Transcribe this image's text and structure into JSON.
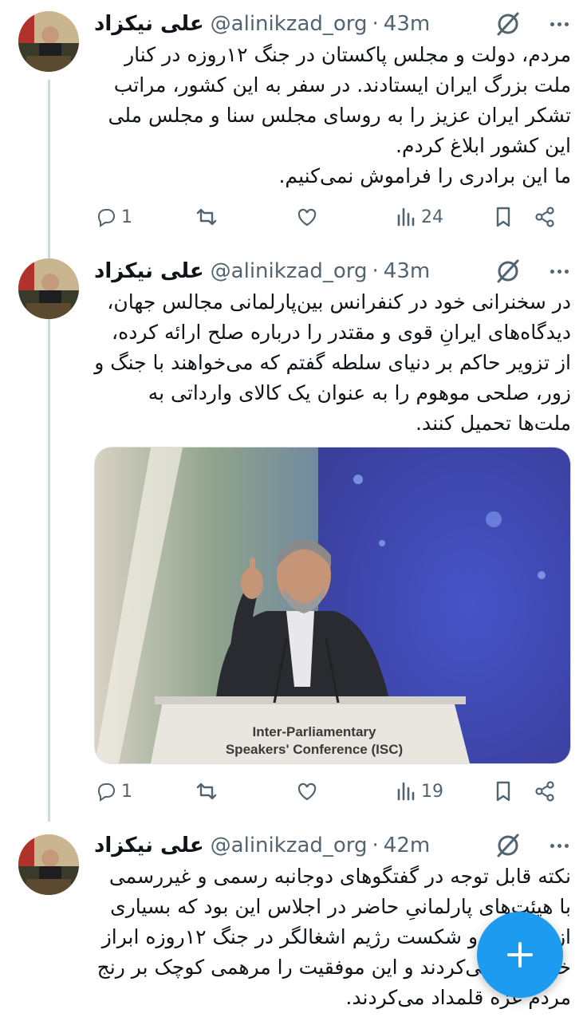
{
  "tweets": [
    {
      "display_name": "علی نیکزاد",
      "handle": "@alinikzad_org",
      "time": "43m",
      "text": "مردم، دولت و مجلس پاکستان در جنگ ۱۲روزه در کنار ملت بزرگ ایران ایستادند. در سفر به این کشور، مراتب تشکر ایران عزیز را به روسای مجلس سنا و مجلس ملی این کشور ابلاغ کردم.\nما این برادری را فراموش نمی‌کنیم.",
      "replies": "1",
      "views": "24"
    },
    {
      "display_name": "علی نیکزاد",
      "handle": "@alinikzad_org",
      "time": "43m",
      "text": "در سخنرانی خود در کنفرانس بین‌پارلمانی مجالس جهان، دیدگاه‌های ایرانِ قوی و مقتدر را درباره صلح ارائه کرده، از تزویر حاکم بر دنیای سلطه گفتم که می‌خواهند با جنگ و زور، صلحی موهوم را به عنوان یک کالای وارداتی به ملت‌ها تحمیل کنند.",
      "media_caption_line1": "Inter-Parliamentary",
      "media_caption_line2": "Speakers' Conference (ISC)",
      "replies": "1",
      "views": "19"
    },
    {
      "display_name": "علی نیکزاد",
      "handle": "@alinikzad_org",
      "time": "42m",
      "text": "نکته قابل توجه در گفتگوهای دوجانبه رسمی و غیررسمی با هیئت‌های پارلمانیِ حاضر در اجلاس این بود که بسیاری از اسرائیل و شکست رژیم اشغالگر در جنگ ۱۲روزه ابراز خرسندی می‌کردند و این موفقیت را مرهمی کوچک بر رنج مردم غزه قلمداد می‌کردند."
    }
  ],
  "dot": "·",
  "fab_icon": "plus-icon",
  "colors": {
    "accent": "#1d9bf0",
    "muted": "#536471",
    "thread_line": "#cfd9de"
  }
}
